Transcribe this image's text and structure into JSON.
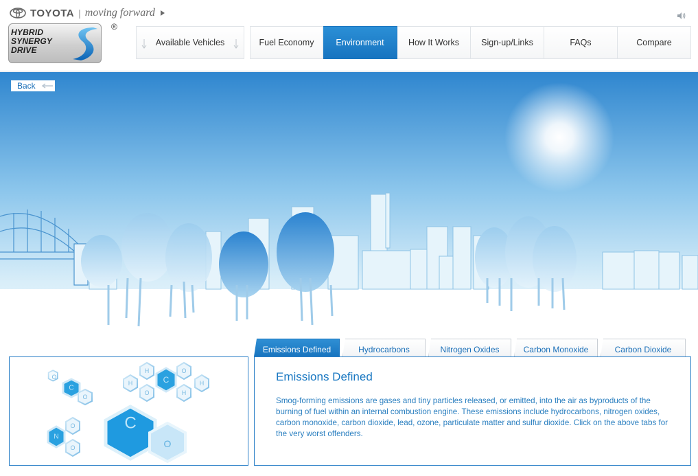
{
  "brand": {
    "company": "TOYOTA",
    "separator": "|",
    "tagline": "moving forward",
    "logo_lines": [
      "HYBRID",
      "SYNERGY",
      "DRIVE"
    ],
    "registered_mark": "®"
  },
  "nav": {
    "tabs": [
      {
        "label": "Available Vehicles",
        "active": false,
        "dropdown": true
      },
      {
        "label": "Fuel Economy",
        "active": false
      },
      {
        "label": "Environment",
        "active": true
      },
      {
        "label": "How It Works",
        "active": false
      },
      {
        "label": "Sign-up/Links",
        "active": false
      },
      {
        "label": "FAQs",
        "active": false
      },
      {
        "label": "Compare",
        "active": false
      }
    ]
  },
  "scene": {
    "back_label": "Back"
  },
  "molecules": {
    "labels": [
      "O",
      "C",
      "O",
      "H",
      "O",
      "H",
      "C",
      "H",
      "O",
      "H",
      "O",
      "C",
      "O",
      "N",
      "O",
      "O"
    ]
  },
  "info_tabs": [
    {
      "label": "Emissions Defined",
      "active": true
    },
    {
      "label": "Hydrocarbons",
      "active": false
    },
    {
      "label": "Nitrogen Oxides",
      "active": false
    },
    {
      "label": "Carbon Monoxide",
      "active": false
    },
    {
      "label": "Carbon Dioxide",
      "active": false
    }
  ],
  "info_panel": {
    "title": "Emissions Defined",
    "body": "Smog-forming emissions are gases and tiny particles released, or emitted, into the air as byproducts of the burning of fuel within an internal combustion engine. These emissions include hydrocarbons, nitrogen oxides, carbon monoxide, carbon dioxide, lead, ozone, particulate matter and sulfur dioxide. Click on the above tabs for the very worst offenders."
  },
  "colors": {
    "accent": "#1a78c2",
    "active_tab": "#1774c0",
    "sky_top": "#2f86cf",
    "sky_bottom": "#e8f4fb"
  },
  "icons": [
    "toyota-emblem-icon",
    "sound-icon",
    "dropdown-arrow-icon",
    "back-arrow-icon"
  ]
}
